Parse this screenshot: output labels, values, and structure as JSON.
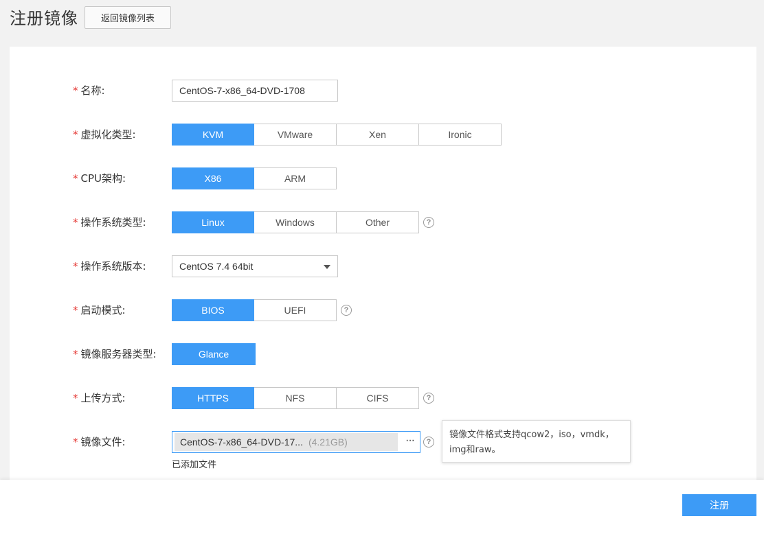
{
  "header": {
    "title": "注册镜像",
    "back_label": "返回镜像列表"
  },
  "form": {
    "required_mark": "*",
    "name": {
      "label": "名称:",
      "value": "CentOS-7-x86_64-DVD-1708"
    },
    "virt_type": {
      "label": "虚拟化类型:",
      "options": [
        "KVM",
        "VMware",
        "Xen",
        "Ironic"
      ],
      "selected": "KVM"
    },
    "cpu_arch": {
      "label": "CPU架构:",
      "options": [
        "X86",
        "ARM"
      ],
      "selected": "X86"
    },
    "os_type": {
      "label": "操作系统类型:",
      "options": [
        "Linux",
        "Windows",
        "Other"
      ],
      "selected": "Linux"
    },
    "os_version": {
      "label": "操作系统版本:",
      "value": "CentOS 7.4 64bit"
    },
    "boot_mode": {
      "label": "启动模式:",
      "options": [
        "BIOS",
        "UEFI"
      ],
      "selected": "BIOS"
    },
    "server_type": {
      "label": "镜像服务器类型:",
      "options": [
        "Glance"
      ],
      "selected": "Glance"
    },
    "upload_method": {
      "label": "上传方式:",
      "options": [
        "HTTPS",
        "NFS",
        "CIFS"
      ],
      "selected": "HTTPS"
    },
    "image_file": {
      "label": "镜像文件:",
      "file_name": "CentOS-7-x86_64-DVD-17...",
      "file_size": "(4.21GB)",
      "more": "···",
      "note": "已添加文件",
      "tooltip": "镜像文件格式支持qcow2，iso，vmdk，img和raw。"
    },
    "help_glyph": "?"
  },
  "footer": {
    "submit_label": "注册"
  },
  "colors": {
    "accent": "#3d9bf6",
    "required": "#e53935"
  }
}
